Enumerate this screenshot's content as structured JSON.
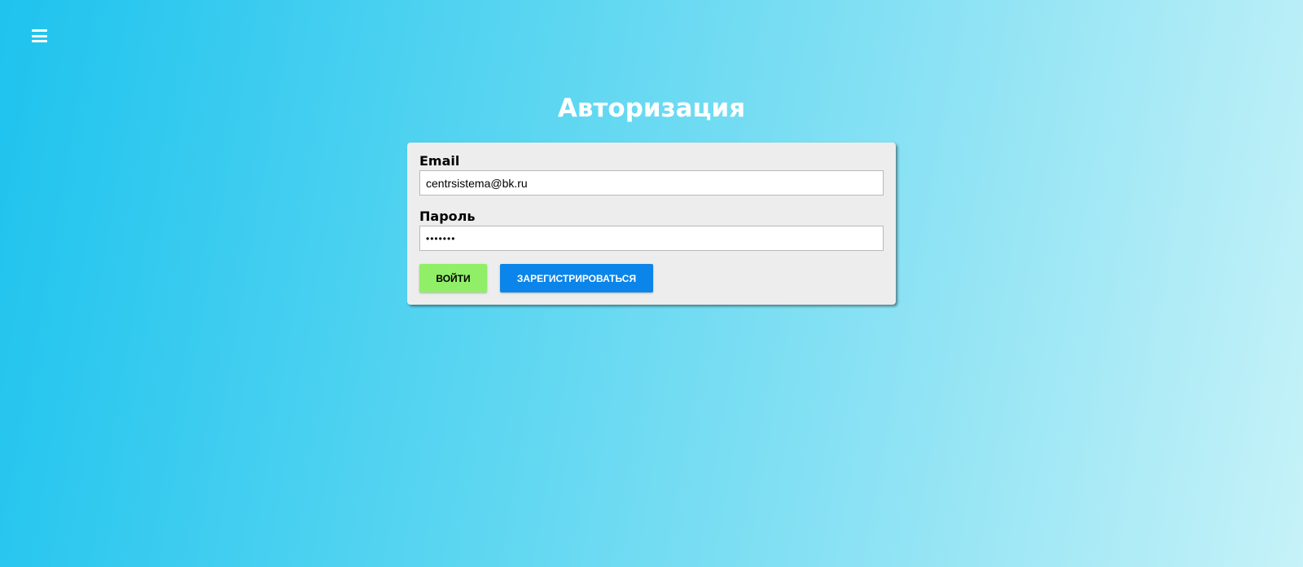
{
  "header": {
    "menu_icon": "hamburger-menu-icon"
  },
  "page": {
    "title": "Авторизация"
  },
  "form": {
    "email": {
      "label": "Email",
      "value": "centrsistema@bk.ru"
    },
    "password": {
      "label": "Пароль",
      "value": "•••••••"
    },
    "buttons": {
      "login_label": "ВОЙТИ",
      "register_label": "ЗАРЕГИСТРИРОВАТЬСЯ"
    }
  },
  "colors": {
    "background_start": "#1ec3ee",
    "background_end": "#c6f2f8",
    "card_background": "#ededed",
    "login_button": "#90ef67",
    "register_button": "#0b85ea"
  }
}
